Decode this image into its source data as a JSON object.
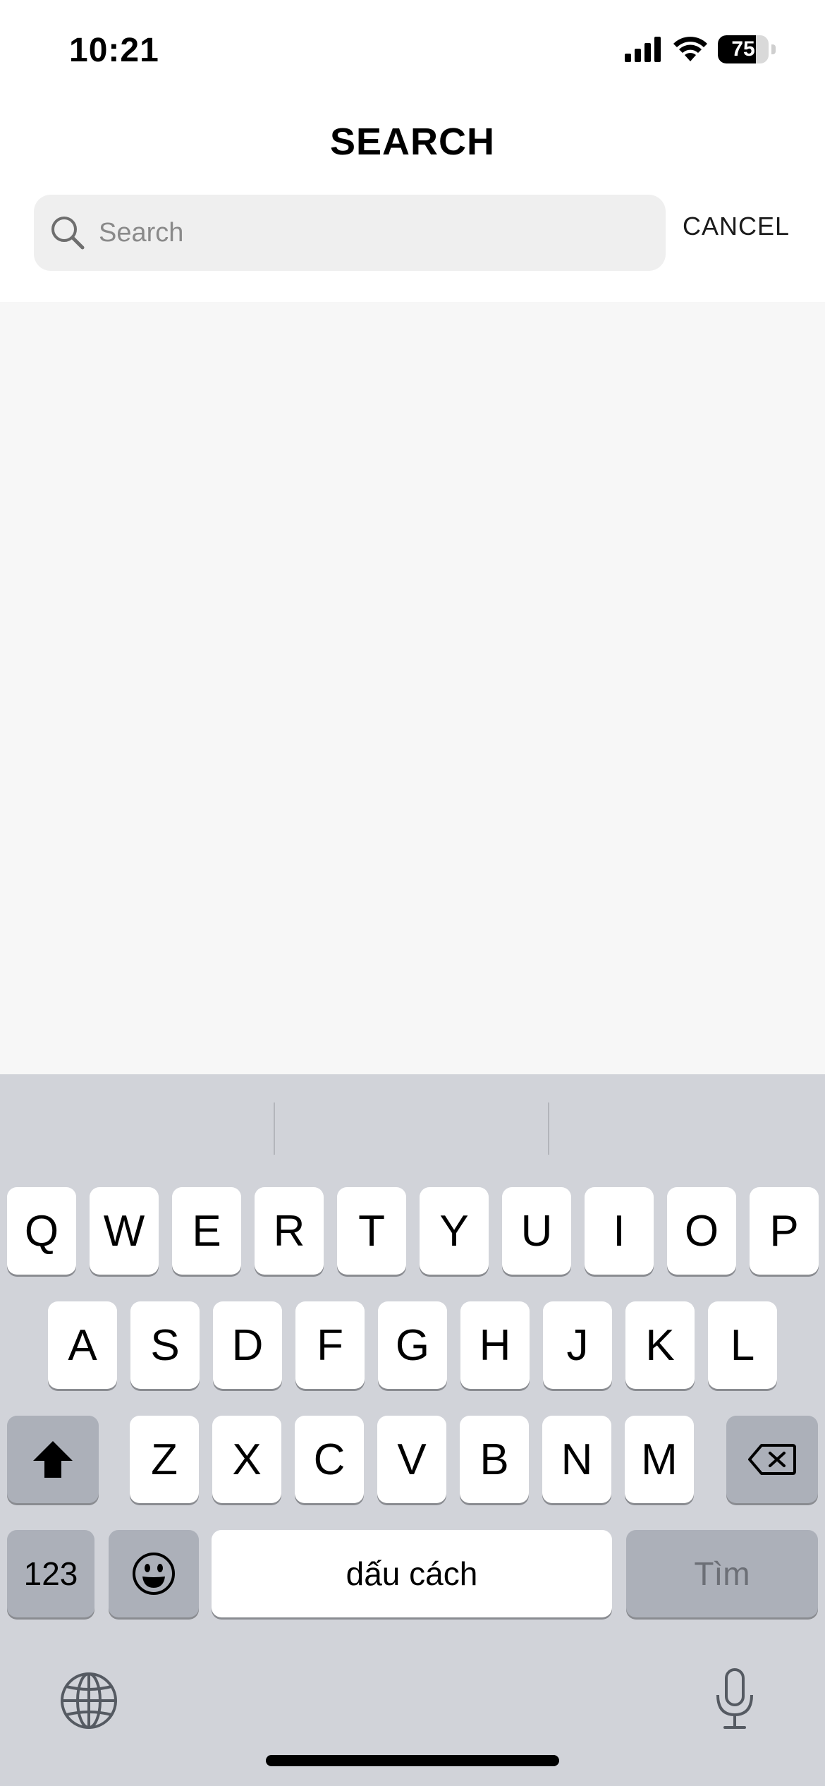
{
  "status_bar": {
    "time": "10:21",
    "battery_level": "75",
    "battery_fraction": 0.75
  },
  "header": {
    "title": "SEARCH"
  },
  "search": {
    "placeholder": "Search",
    "value": "",
    "cancel_label": "CANCEL"
  },
  "keyboard": {
    "row1": [
      "Q",
      "W",
      "E",
      "R",
      "T",
      "Y",
      "U",
      "I",
      "O",
      "P"
    ],
    "row2": [
      "A",
      "S",
      "D",
      "F",
      "G",
      "H",
      "J",
      "K",
      "L"
    ],
    "row3": [
      "Z",
      "X",
      "C",
      "V",
      "B",
      "N",
      "M"
    ],
    "numbers_label": "123",
    "space_label": "dấu cách",
    "go_label": "Tìm",
    "icons": {
      "shift": "shift-icon",
      "backspace": "backspace-icon",
      "emoji": "emoji-icon",
      "globe": "globe-icon",
      "mic": "microphone-icon"
    }
  },
  "colors": {
    "keyboard_bg": "#d1d3d9",
    "content_bg": "#f7f7f7",
    "search_bg": "#efefef",
    "dark_key": "#acb0b9"
  }
}
